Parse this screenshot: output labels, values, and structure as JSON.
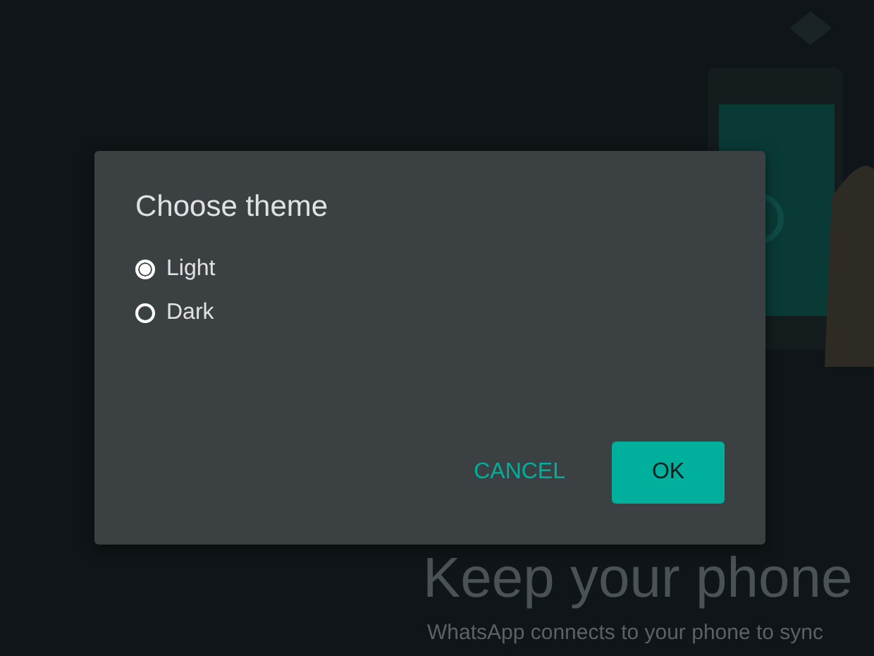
{
  "background": {
    "heading": "Keep your phone",
    "text": "WhatsApp connects to your phone to sync"
  },
  "dialog": {
    "title": "Choose theme",
    "options": [
      {
        "label": "Light",
        "selected": true
      },
      {
        "label": "Dark",
        "selected": false
      }
    ],
    "buttons": [
      {
        "label": "CANCEL",
        "kind": "text"
      },
      {
        "label": "OK",
        "kind": "filled"
      }
    ]
  }
}
